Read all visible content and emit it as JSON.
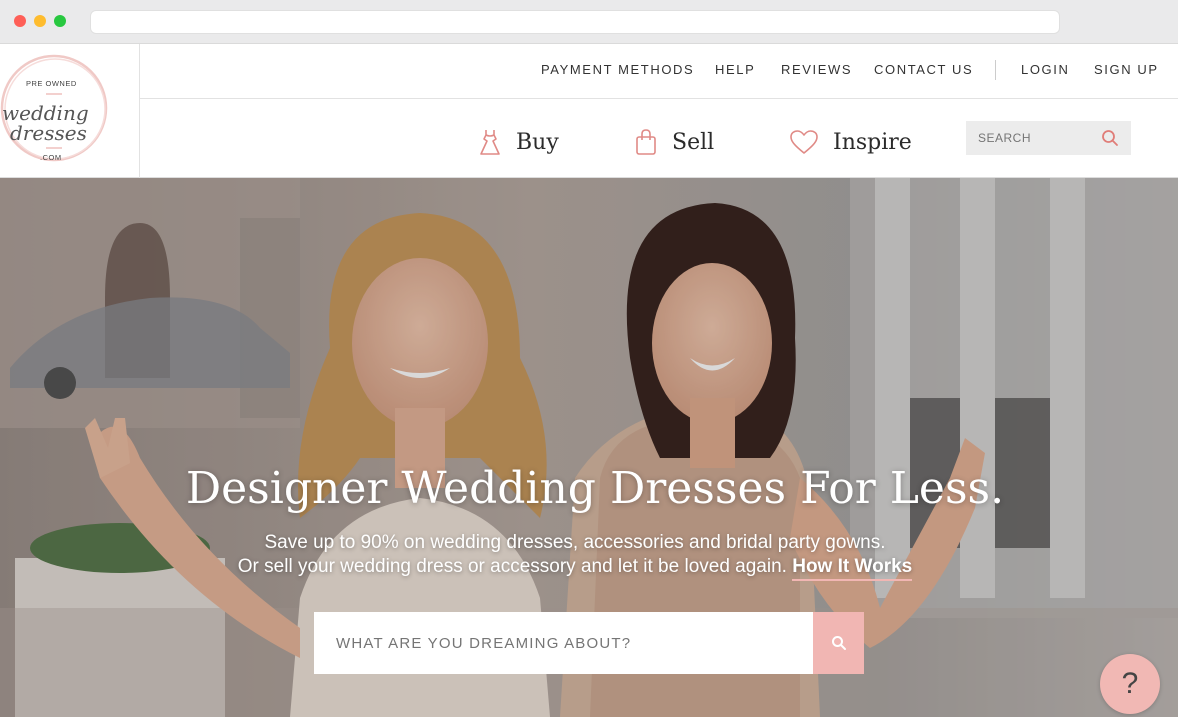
{
  "top_nav": {
    "payment_methods": "PAYMENT METHODS",
    "help": "HELP",
    "reviews": "REVIEWS",
    "contact_us": "CONTACT US",
    "login": "LOGIN",
    "sign_up": "SIGN UP"
  },
  "logo": {
    "top_text": "PRE OWNED",
    "line1": "wedding",
    "line2": "dresses",
    "suffix": ".COM"
  },
  "main_nav": [
    {
      "label": "Buy",
      "icon": "dress-icon"
    },
    {
      "label": "Sell",
      "icon": "shopping-bag-icon"
    },
    {
      "label": "Inspire",
      "icon": "heart-icon"
    }
  ],
  "header_search": {
    "placeholder": "SEARCH"
  },
  "hero": {
    "title": "Designer Wedding Dresses For Less.",
    "subtitle_line1": "Save up to 90% on wedding dresses, accessories and bridal party gowns.",
    "subtitle_line2": "Or sell your wedding dress or accessory and let it be loved again.",
    "how_it_works": "How It Works",
    "search_placeholder": "WHAT ARE YOU DREAMING ABOUT?"
  },
  "help_bubble": "?",
  "colors": {
    "accent": "#f1b6b3",
    "icon_stroke": "#e08a86"
  }
}
